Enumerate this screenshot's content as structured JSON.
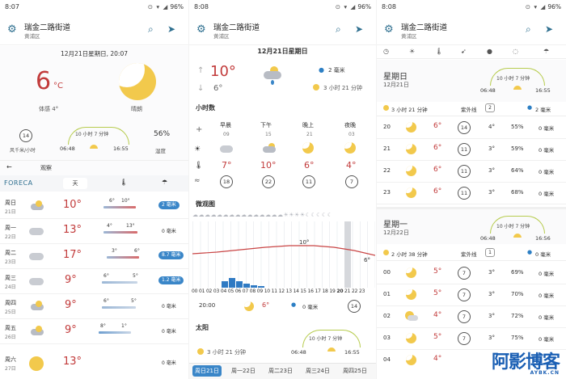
{
  "panel1": {
    "status_time": "8:07",
    "battery": "96%",
    "city": "瑞金二路街道",
    "district": "黄浦区",
    "date_line": "12月21日星期日, 20:07",
    "temp_big": "6",
    "temp_unit": "°C",
    "feels": "体感 4°",
    "condition": "晴朗",
    "wind_speed": "14",
    "wind_unit": "风千米/小时",
    "sunrise": "06:48",
    "sunset": "16:55",
    "daylen": "10 小时 7 分钟",
    "humidity": "56%",
    "humidity_label": "湿度",
    "observe_label": "观察",
    "logo": "FORECA",
    "tab_day": "天",
    "days": [
      {
        "name": "周日",
        "date": "21日",
        "temp": "10°",
        "lo": "6°",
        "hi": "10°",
        "rain": "2 毫米",
        "rain_pill": true
      },
      {
        "name": "周一",
        "date": "22日",
        "temp": "13°",
        "lo": "4°",
        "hi": "13°",
        "rain": "0 毫米",
        "rain_pill": false
      },
      {
        "name": "周二",
        "date": "23日",
        "temp": "17°",
        "lo": "3°",
        "hi": "6°",
        "rain": "8.7 毫米",
        "rain_pill": true
      },
      {
        "name": "周三",
        "date": "24日",
        "temp": "9°",
        "lo": "6°",
        "hi": "5°",
        "rain": "1.2 毫米",
        "rain_pill": true
      },
      {
        "name": "周四",
        "date": "25日",
        "temp": "9°",
        "lo": "6°",
        "hi": "5°",
        "rain": "0 毫米",
        "rain_pill": false
      },
      {
        "name": "周五",
        "date": "26日",
        "temp": "9°",
        "lo": "8°",
        "hi": "1°",
        "rain": "0 毫米",
        "rain_pill": false
      },
      {
        "name": "周六",
        "date": "27日",
        "temp": "13°",
        "lo": "",
        "hi": "",
        "rain": "0 毫米",
        "rain_pill": false
      }
    ]
  },
  "panel2": {
    "status_time": "8:08",
    "battery": "96%",
    "city": "瑞金二路街道",
    "district": "黄浦区",
    "date_line": "12月21日星期日",
    "hi": "10°",
    "lo": "6°",
    "rain": "2 毫米",
    "sun_duration": "3 小时 21 分钟",
    "hourly_label": "小时数",
    "periods": [
      {
        "name": "早晨",
        "hour": "09",
        "temp": "7°",
        "wind": "18"
      },
      {
        "name": "下午",
        "hour": "15",
        "temp": "10°",
        "wind": "22"
      },
      {
        "name": "晚上",
        "hour": "21",
        "temp": "6°",
        "wind": "11"
      },
      {
        "name": "夜晚",
        "hour": "03",
        "temp": "4°",
        "wind": "7"
      }
    ],
    "micro_label": "微观图",
    "graph_max": "10°",
    "graph_end": "6°",
    "hours": [
      "00",
      "01",
      "02",
      "03",
      "04",
      "05",
      "06",
      "07",
      "08",
      "09",
      "10",
      "11",
      "12",
      "13",
      "14",
      "15",
      "16",
      "17",
      "18",
      "19",
      "20",
      "21",
      "22",
      "23"
    ],
    "row_time": "20:00",
    "row_temp": "6°",
    "row_rain": "0 毫米",
    "row_wind": "14",
    "sun_label": "太阳",
    "sun2_duration": "3 小时 21 分钟",
    "daylen": "10 小时 7 分钟",
    "sunrise": "06:48",
    "sunset": "16:55",
    "tabs": [
      "周日21日",
      "周一22日",
      "周二23日",
      "周三24日",
      "周四25日"
    ]
  },
  "panel3": {
    "status_time": "8:08",
    "battery": "96%",
    "city": "瑞金二路街道",
    "district": "黄浦区",
    "day1": {
      "name": "星期日",
      "date": "12月21日",
      "daylen": "10 小时 7 分钟",
      "sunrise": "06:48",
      "sunset": "16:55",
      "sun": "3 小时 21 分钟",
      "uv_label": "紫外线",
      "uv": "2",
      "rain": "2 毫米",
      "rows": [
        {
          "hour": "20",
          "temp": "6°",
          "wind": "14",
          "feel": "4°",
          "hum": "55%",
          "rain": "0 毫米"
        },
        {
          "hour": "21",
          "temp": "6°",
          "wind": "11",
          "feel": "3°",
          "hum": "59%",
          "rain": "0 毫米"
        },
        {
          "hour": "22",
          "temp": "6°",
          "wind": "11",
          "feel": "3°",
          "hum": "64%",
          "rain": "0 毫米"
        },
        {
          "hour": "23",
          "temp": "6°",
          "wind": "11",
          "feel": "3°",
          "hum": "68%",
          "rain": "0 毫米"
        }
      ]
    },
    "day2": {
      "name": "星期一",
      "date": "12月22日",
      "daylen": "10 小时 7 分钟",
      "sunrise": "06:48",
      "sunset": "16:56",
      "sun": "2 小时 38 分钟",
      "uv_label": "紫外线",
      "uv": "1",
      "rain": "0 毫米",
      "rows": [
        {
          "hour": "00",
          "temp": "5°",
          "wind": "7",
          "feel": "3°",
          "hum": "69%",
          "rain": "0 毫米"
        },
        {
          "hour": "01",
          "temp": "5°",
          "wind": "7",
          "feel": "3°",
          "hum": "70%",
          "rain": "0 毫米"
        },
        {
          "hour": "02",
          "temp": "4°",
          "wind": "7",
          "feel": "3°",
          "hum": "72%",
          "rain": "0 毫米"
        },
        {
          "hour": "03",
          "temp": "5°",
          "wind": "7",
          "feel": "3°",
          "hum": "75%",
          "rain": "0 毫米"
        },
        {
          "hour": "04",
          "temp": "4°",
          "wind": "",
          "feel": "",
          "hum": "",
          "rain": "0 毫米"
        }
      ]
    }
  },
  "watermark": "阿影博客",
  "watermark_sub": "AYBK.CN"
}
